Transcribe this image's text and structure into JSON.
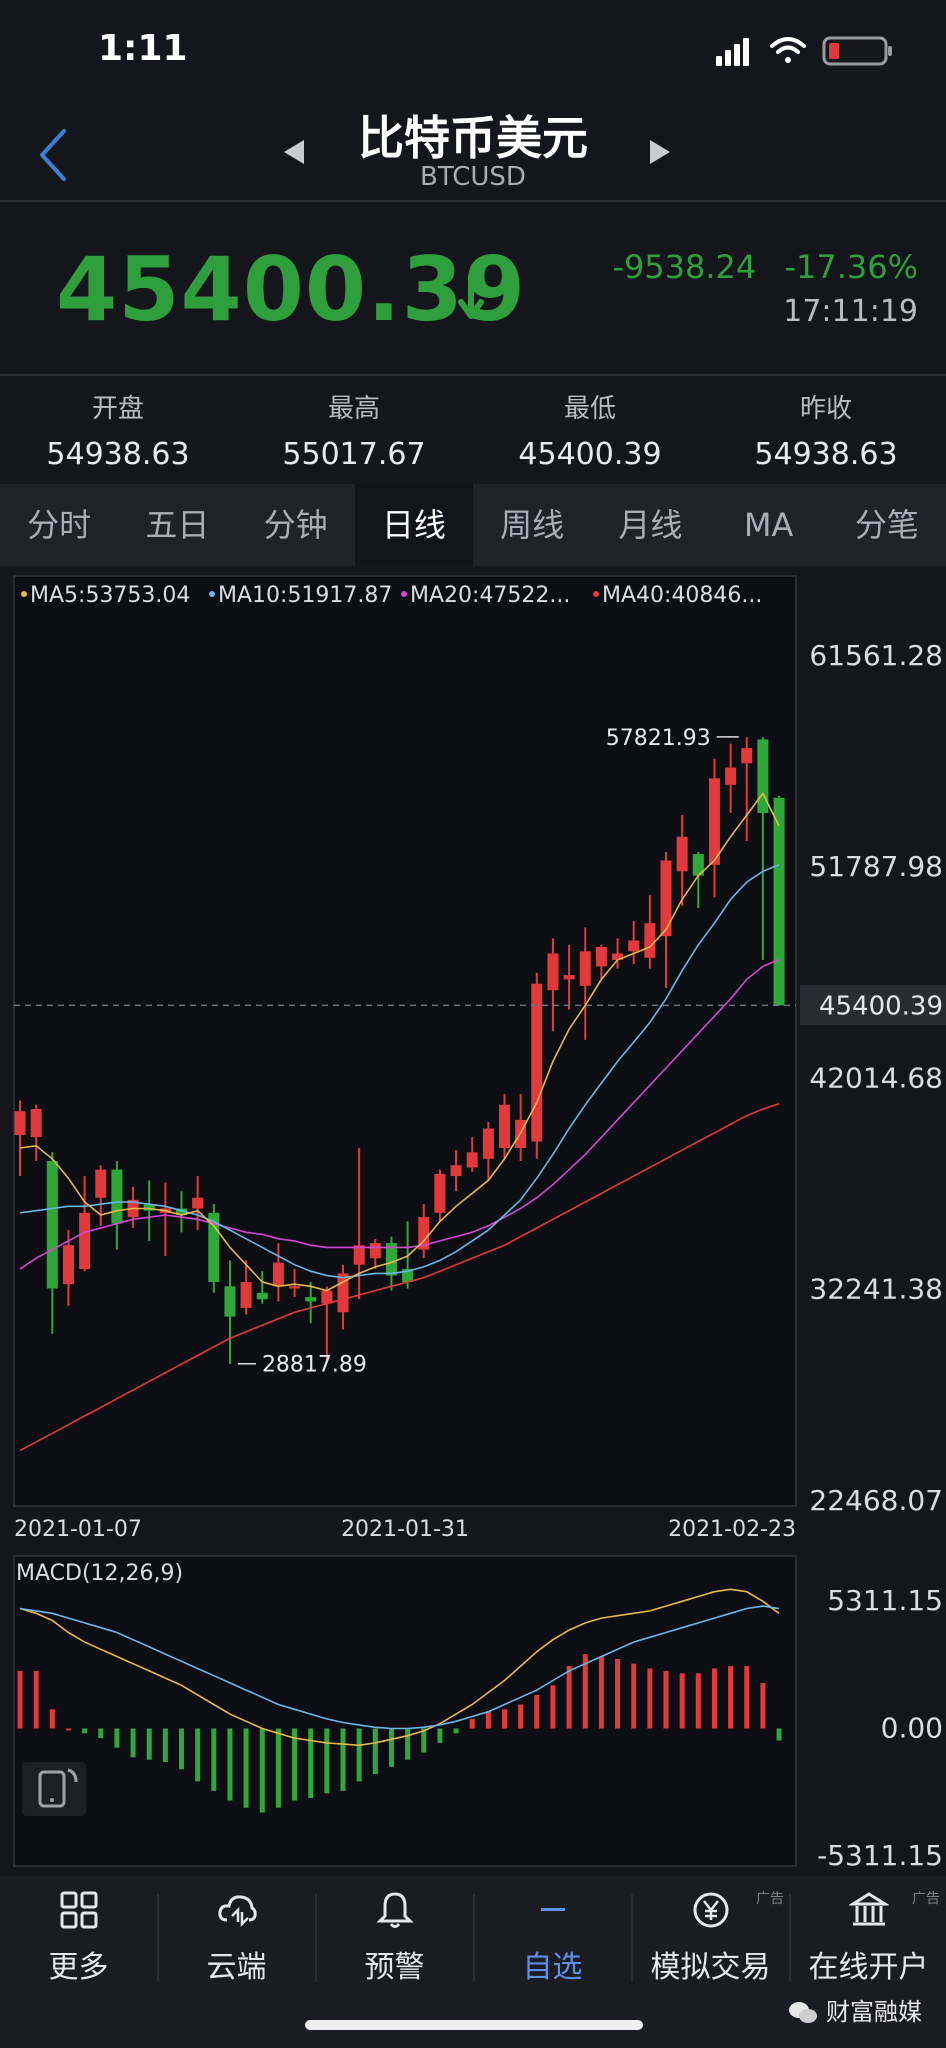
{
  "status": {
    "time": "1:11"
  },
  "header": {
    "title": "比特币美元",
    "symbol": "BTCUSD"
  },
  "quote": {
    "price": "45400.39",
    "change": "-9538.24",
    "change_pct": "-17.36%",
    "time": "17:11:19",
    "color_down": "#2f9e3c"
  },
  "stats": [
    {
      "label": "开盘",
      "value": "54938.63"
    },
    {
      "label": "最高",
      "value": "55017.67"
    },
    {
      "label": "最低",
      "value": "45400.39"
    },
    {
      "label": "昨收",
      "value": "54938.63"
    }
  ],
  "tabs": [
    "分时",
    "五日",
    "分钟",
    "日线",
    "周线",
    "月线",
    "MA",
    "分笔"
  ],
  "active_tab": "日线",
  "chart_data": {
    "type": "candlestick",
    "ma_legend": [
      {
        "text": "MA5:53753.04",
        "color": "#e8b84a"
      },
      {
        "text": "MA10:51917.87",
        "color": "#6bb7e8"
      },
      {
        "text": "MA20:47522...",
        "color": "#d447d4"
      },
      {
        "text": "MA40:40846...",
        "color": "#e23a3a"
      }
    ],
    "y_ticks": [
      "61561.28",
      "51787.98",
      "42014.68",
      "32241.38",
      "22468.07"
    ],
    "ylim": [
      22468.07,
      61561.28
    ],
    "current_price_label": "45400.39",
    "current_price": 45400.39,
    "high_annotation": "57821.93",
    "high_value": 57821.93,
    "low_annotation": "28817.89",
    "low_value": 28817.89,
    "x_ticks": [
      "2021-01-07",
      "2021-01-31",
      "2021-02-23"
    ],
    "candles": [
      {
        "o": 39400,
        "h": 41000,
        "l": 37500,
        "c": 40500
      },
      {
        "o": 39300,
        "h": 40800,
        "l": 38200,
        "c": 40600
      },
      {
        "o": 38200,
        "h": 38600,
        "l": 30200,
        "c": 32300
      },
      {
        "o": 32500,
        "h": 35000,
        "l": 31500,
        "c": 34300
      },
      {
        "o": 33200,
        "h": 37500,
        "l": 33100,
        "c": 35800
      },
      {
        "o": 36500,
        "h": 38000,
        "l": 35200,
        "c": 37800
      },
      {
        "o": 37800,
        "h": 38200,
        "l": 34100,
        "c": 35300
      },
      {
        "o": 35600,
        "h": 37000,
        "l": 35100,
        "c": 36400
      },
      {
        "o": 36200,
        "h": 37300,
        "l": 34500,
        "c": 35900
      },
      {
        "o": 35800,
        "h": 37200,
        "l": 33800,
        "c": 36000
      },
      {
        "o": 36000,
        "h": 36800,
        "l": 34900,
        "c": 35700
      },
      {
        "o": 36000,
        "h": 37500,
        "l": 35000,
        "c": 36500
      },
      {
        "o": 35800,
        "h": 36200,
        "l": 32100,
        "c": 32600
      },
      {
        "o": 32400,
        "h": 33600,
        "l": 28800,
        "c": 31000
      },
      {
        "o": 31400,
        "h": 33600,
        "l": 31100,
        "c": 32600
      },
      {
        "o": 32100,
        "h": 33100,
        "l": 31600,
        "c": 31800
      },
      {
        "o": 32400,
        "h": 34400,
        "l": 31700,
        "c": 33500
      },
      {
        "o": 32300,
        "h": 33200,
        "l": 31900,
        "c": 32400
      },
      {
        "o": 31900,
        "h": 32600,
        "l": 30700,
        "c": 31700
      },
      {
        "o": 31600,
        "h": 32400,
        "l": 28900,
        "c": 32200
      },
      {
        "o": 31200,
        "h": 33400,
        "l": 30400,
        "c": 33000
      },
      {
        "o": 33400,
        "h": 38800,
        "l": 31800,
        "c": 34300
      },
      {
        "o": 33700,
        "h": 34600,
        "l": 33200,
        "c": 34400
      },
      {
        "o": 34400,
        "h": 34700,
        "l": 32200,
        "c": 32900
      },
      {
        "o": 33200,
        "h": 35400,
        "l": 32300,
        "c": 32600
      },
      {
        "o": 34100,
        "h": 36200,
        "l": 33700,
        "c": 35600
      },
      {
        "o": 35800,
        "h": 37800,
        "l": 35400,
        "c": 37600
      },
      {
        "o": 37500,
        "h": 38700,
        "l": 36800,
        "c": 38000
      },
      {
        "o": 37900,
        "h": 39300,
        "l": 37700,
        "c": 38600
      },
      {
        "o": 38300,
        "h": 40000,
        "l": 37300,
        "c": 39700
      },
      {
        "o": 38800,
        "h": 41300,
        "l": 38300,
        "c": 40800
      },
      {
        "o": 38800,
        "h": 41300,
        "l": 38200,
        "c": 40100
      },
      {
        "o": 39100,
        "h": 46900,
        "l": 38300,
        "c": 46400
      },
      {
        "o": 46100,
        "h": 48500,
        "l": 44200,
        "c": 47800
      },
      {
        "o": 46600,
        "h": 48200,
        "l": 45200,
        "c": 46800
      },
      {
        "o": 46300,
        "h": 49000,
        "l": 43800,
        "c": 47900
      },
      {
        "o": 47200,
        "h": 48200,
        "l": 46600,
        "c": 48100
      },
      {
        "o": 47500,
        "h": 48500,
        "l": 47100,
        "c": 47800
      },
      {
        "o": 47900,
        "h": 49300,
        "l": 47300,
        "c": 48400
      },
      {
        "o": 47600,
        "h": 50500,
        "l": 47100,
        "c": 49200
      },
      {
        "o": 48600,
        "h": 52500,
        "l": 46200,
        "c": 52100
      },
      {
        "o": 51600,
        "h": 54200,
        "l": 50000,
        "c": 53200
      },
      {
        "o": 52400,
        "h": 52500,
        "l": 49900,
        "c": 51400
      },
      {
        "o": 51900,
        "h": 56800,
        "l": 50400,
        "c": 55900
      },
      {
        "o": 55600,
        "h": 57500,
        "l": 54300,
        "c": 56400
      },
      {
        "o": 56600,
        "h": 57800,
        "l": 53000,
        "c": 57300
      },
      {
        "o": 57700,
        "h": 57800,
        "l": 47500,
        "c": 54300
      },
      {
        "o": 55000,
        "h": 55100,
        "l": 45400,
        "c": 45400
      }
    ],
    "ma5": [
      38800,
      38900,
      38300,
      37400,
      36300,
      35700,
      35900,
      36000,
      36000,
      35900,
      35700,
      35900,
      35200,
      34200,
      33400,
      32600,
      32400,
      32500,
      32400,
      32200,
      32600,
      33000,
      33300,
      33500,
      33800,
      34500,
      35400,
      36100,
      36700,
      37300,
      38300,
      39500,
      40900,
      42800,
      44300,
      45400,
      46600,
      47500,
      47800,
      48100,
      48900,
      50300,
      51400,
      52100,
      53200,
      54200,
      55200,
      53700
    ],
    "ma10": [
      35800,
      35900,
      36000,
      36100,
      36100,
      36200,
      36300,
      36300,
      36200,
      36100,
      35900,
      35700,
      35400,
      35000,
      34600,
      34200,
      33800,
      33400,
      33100,
      32900,
      32800,
      32900,
      33000,
      33000,
      33100,
      33300,
      33600,
      34000,
      34500,
      35000,
      35700,
      36400,
      37400,
      38500,
      39700,
      40800,
      41800,
      42800,
      43700,
      44600,
      45700,
      47000,
      48200,
      49200,
      50300,
      51100,
      51600,
      51900
    ],
    "ma20": [
      33200,
      33700,
      34100,
      34500,
      34900,
      35100,
      35300,
      35500,
      35600,
      35700,
      35600,
      35500,
      35300,
      35100,
      34900,
      34800,
      34600,
      34500,
      34300,
      34200,
      34200,
      34200,
      34200,
      34200,
      34200,
      34300,
      34500,
      34700,
      34900,
      35200,
      35600,
      36000,
      36500,
      37100,
      37800,
      38500,
      39300,
      40100,
      40900,
      41700,
      42500,
      43300,
      44100,
      44900,
      45700,
      46600,
      47200,
      47520
    ],
    "ma40": [
      24800,
      25200,
      25600,
      26000,
      26400,
      26800,
      27200,
      27600,
      28000,
      28400,
      28800,
      29200,
      29600,
      30000,
      30300,
      30600,
      30900,
      31200,
      31400,
      31600,
      31800,
      32000,
      32200,
      32400,
      32600,
      32800,
      33100,
      33400,
      33700,
      34000,
      34300,
      34700,
      35100,
      35500,
      35900,
      36300,
      36700,
      37100,
      37500,
      37900,
      38300,
      38700,
      39100,
      39500,
      39900,
      40300,
      40600,
      40850
    ],
    "macd": {
      "label": "MACD(12,26,9)",
      "y_ticks": [
        "5311.15",
        "0.00",
        "-5311.15"
      ],
      "ylim": [
        -5311.15,
        5311.15
      ],
      "hist": [
        2400,
        2400,
        800,
        0,
        -200,
        -400,
        -800,
        -1200,
        -1300,
        -1400,
        -1700,
        -2200,
        -2600,
        -3000,
        -3300,
        -3500,
        -3300,
        -3000,
        -2900,
        -2700,
        -2600,
        -2200,
        -1900,
        -1600,
        -1300,
        -1000,
        -600,
        -200,
        400,
        700,
        800,
        1000,
        1400,
        1800,
        2600,
        3100,
        3000,
        2900,
        2700,
        2500,
        2400,
        2300,
        2300,
        2500,
        2600,
        2600,
        1900,
        -500
      ],
      "dif": [
        5000,
        4800,
        4500,
        4000,
        3600,
        3300,
        3000,
        2700,
        2400,
        2100,
        1800,
        1400,
        1000,
        600,
        300,
        0,
        -200,
        -400,
        -500,
        -600,
        -650,
        -700,
        -600,
        -450,
        -300,
        -100,
        200,
        600,
        1000,
        1500,
        2000,
        2600,
        3200,
        3700,
        4100,
        4400,
        4600,
        4700,
        4800,
        4900,
        5100,
        5300,
        5500,
        5700,
        5800,
        5700,
        5300,
        4800
      ],
      "dea": [
        5000,
        4900,
        4800,
        4600,
        4400,
        4200,
        4000,
        3700,
        3400,
        3100,
        2800,
        2500,
        2200,
        1900,
        1600,
        1300,
        1000,
        800,
        600,
        400,
        250,
        150,
        50,
        0,
        0,
        50,
        150,
        300,
        500,
        700,
        1000,
        1300,
        1600,
        2000,
        2400,
        2700,
        3000,
        3300,
        3600,
        3800,
        4000,
        4200,
        4400,
        4600,
        4800,
        5000,
        5100,
        5000
      ]
    }
  },
  "nav": [
    {
      "label": "更多",
      "icon": "grid-icon"
    },
    {
      "label": "云端",
      "icon": "cloud-sync-icon"
    },
    {
      "label": "预警",
      "icon": "bell-icon"
    },
    {
      "label": "自选",
      "icon": "minus-icon",
      "active": true
    },
    {
      "label": "模拟交易",
      "icon": "yen-icon",
      "ad": "广告"
    },
    {
      "label": "在线开户",
      "icon": "bank-icon",
      "ad": "广告"
    }
  ],
  "watermark": "财富融媒"
}
